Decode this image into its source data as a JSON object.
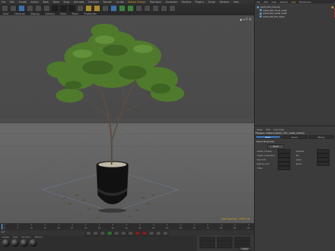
{
  "menubar": {
    "items": [
      "File",
      "Edit",
      "Create",
      "Select",
      "Tools",
      "Mesh",
      "Snap",
      "Animate",
      "Simulate",
      "Render",
      "Sculpt",
      "Motion Tracker",
      "MoGraph",
      "Character",
      "Pipeline",
      "Plugins",
      "Script",
      "Window",
      "Help"
    ],
    "highlight_index": 11
  },
  "viewport": {
    "menu": [
      "View",
      "Cameras",
      "Display",
      "Options",
      "Filter",
      "Panel",
      "ProRender"
    ],
    "hud": "▲ ⇔ C ⊡",
    "grid_label": "Grid Spacing : 1000 cm",
    "background_top": "#4d4d4d",
    "floor_color": "#6b6b6b",
    "foliage_color": "#4f7a2c",
    "pot_color": "#111111"
  },
  "timeline": {
    "start_frame": "0 F",
    "ticks": [
      "0",
      "5",
      "10",
      "15",
      "20",
      "25",
      "30",
      "35",
      "40",
      "45",
      "50",
      "55",
      "60",
      "65",
      "70",
      "75",
      "80",
      "85",
      "90"
    ]
  },
  "materials": {
    "menu": [
      "Create",
      "Edit",
      "Function",
      "Texture"
    ],
    "count": 4
  },
  "coords": {
    "apply": "Apply",
    "rows": [
      "X",
      "Y",
      "Z"
    ]
  },
  "object_manager": {
    "menu": [
      "File",
      "Edit",
      "View",
      "Objects",
      "Tags",
      "Bookmarks"
    ],
    "highlight_index": 4,
    "objects": [
      {
        "name": "plant_001_tree.obj",
        "tag_color": "#c8842a"
      },
      {
        "name": "plant_001_Trunk_mesh",
        "tag_color": "#d23a3a"
      },
      {
        "name": "plant_001_Leafs_mesh",
        "tag_color": "#d23a3a"
      },
      {
        "name": "plant_001_Pot_mesh",
        "tag_color": "#d23a3a"
      }
    ]
  },
  "attributes": {
    "tabs": [
      "Mode",
      "Edit",
      "User Data"
    ],
    "title": "Polygon Object [plant_001_Leafs_mesh]",
    "modes": [
      "Basic",
      "Coord.",
      "Phong"
    ],
    "section": "Object Properties",
    "rows_left": [
      "Visible in Editor",
      "Visible in Renderer",
      "Use Color",
      "Display Color",
      "X-Ray"
    ],
    "rows_right": [
      "Enabled",
      "Bit",
      "Layer",
      "Name"
    ],
    "reset_button": "Reset"
  }
}
